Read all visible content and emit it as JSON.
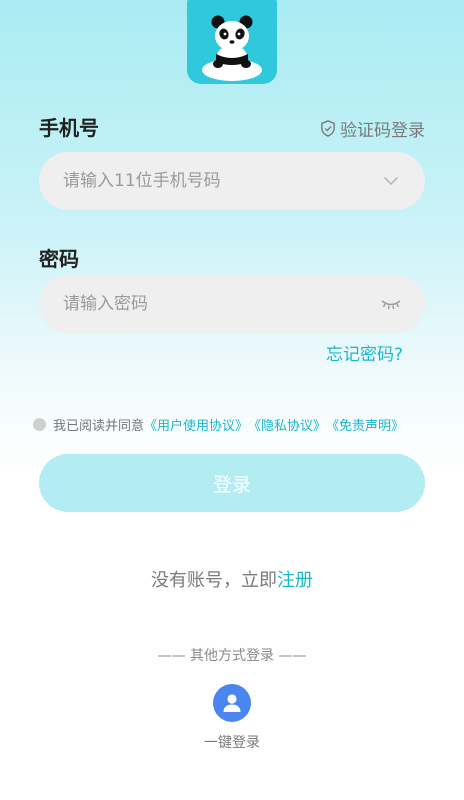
{
  "form": {
    "phone_label": "手机号",
    "code_login": "验证码登录",
    "phone_placeholder": "请输入11位手机号码",
    "password_label": "密码",
    "password_placeholder": "请输入密码",
    "forgot": "忘记密码?"
  },
  "agreement": {
    "prefix": "我已阅读并同意",
    "user_agreement": "《用户使用协议》",
    "privacy": "《隐私协议》",
    "disclaimer": "《免责声明》"
  },
  "login_button": "登录",
  "register": {
    "text": "没有账号，立即",
    "link": "注册"
  },
  "other_login": {
    "title": "—— 其他方式登录 ——",
    "one_click": "一键登录"
  },
  "colors": {
    "accent": "#1ab6cc",
    "logo_bg": "#2fc8dc",
    "button_bg": "#b4ecf3",
    "one_click_bg": "#4a86f0"
  },
  "icons": {
    "logo": "panda-logo-icon",
    "code_login": "shield-check-icon",
    "phone_trailing": "chevron-down-icon",
    "password_trailing": "eye-closed-icon",
    "one_click": "user-icon"
  }
}
